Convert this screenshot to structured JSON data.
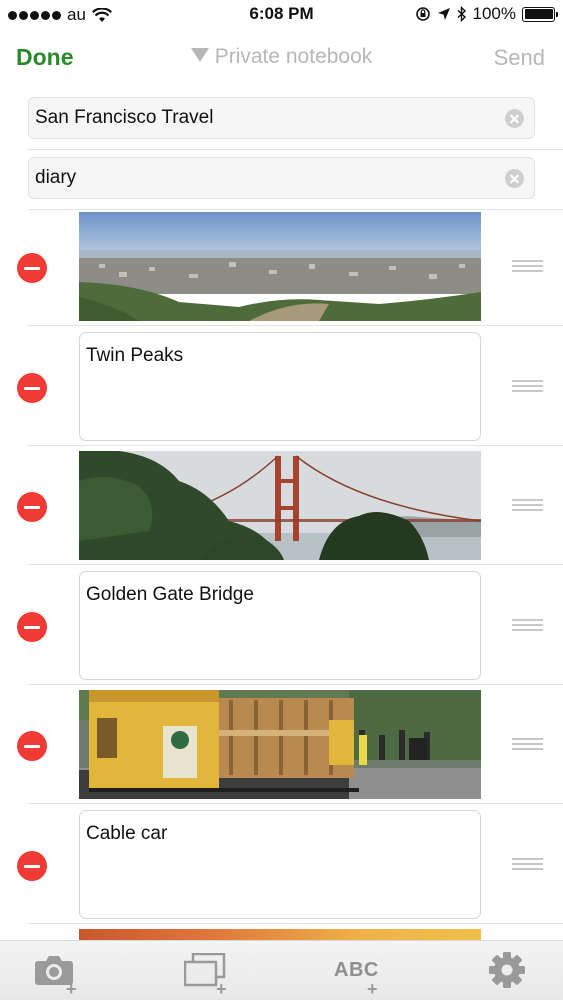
{
  "status_bar": {
    "carrier": "au",
    "time": "6:08 PM",
    "battery": "100%"
  },
  "nav": {
    "done_label": "Done",
    "notebook_label": "Private notebook",
    "send_label": "Send"
  },
  "fields": {
    "title_value": "San Francisco Travel",
    "tags_value": "diary"
  },
  "items": [
    {
      "type": "photo",
      "subject": "city panorama"
    },
    {
      "type": "text",
      "text": "Twin Peaks"
    },
    {
      "type": "photo",
      "subject": "golden gate bridge"
    },
    {
      "type": "text",
      "text": "Golden Gate Bridge"
    },
    {
      "type": "photo",
      "subject": "cable car"
    },
    {
      "type": "text",
      "text": "Cable car"
    }
  ],
  "toolbar": {
    "abc_label": "ABC"
  },
  "colors": {
    "accent_done": "#2a8a2a",
    "delete_red": "#ef3b33",
    "disabled_gray": "#b7b7b7"
  }
}
